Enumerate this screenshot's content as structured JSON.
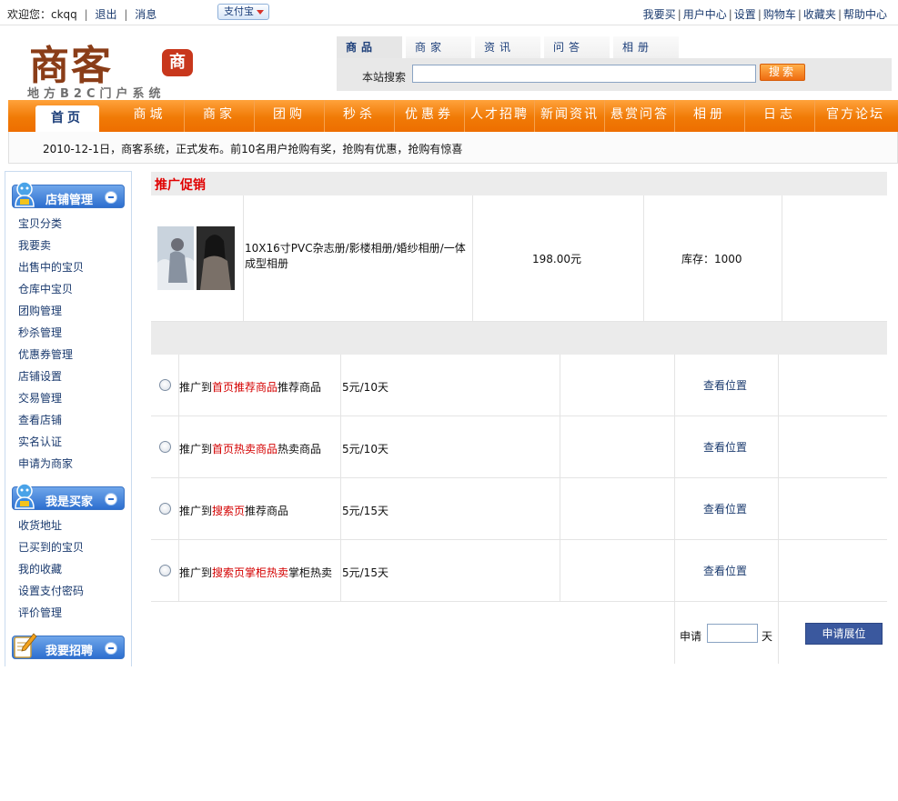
{
  "topbar": {
    "welcome": "欢迎您：ckqq",
    "logout": "退出",
    "messages": "消息",
    "alipay": "支付宝",
    "links": [
      "我要买",
      "用户中心",
      "设置",
      "购物车",
      "收藏夹",
      "帮助中心"
    ]
  },
  "logo": {
    "main": "商客",
    "seal": "商",
    "tagline": "地方B2C门户系统"
  },
  "search": {
    "tabs": [
      "商品",
      "商家",
      "资讯",
      "问答",
      "相册"
    ],
    "active_tab": "商品",
    "label": "本站搜索",
    "value": "",
    "button": "搜索"
  },
  "nav": {
    "items": [
      "首页",
      "商城",
      "商家",
      "团购",
      "秒杀",
      "优惠券",
      "人才招聘",
      "新闻资讯",
      "悬赏问答",
      "相册",
      "日志",
      "官方论坛"
    ],
    "active": "首页"
  },
  "notice": "2010-12-1日，商客系统，正式发布。前10名用户抢购有奖，抢购有优惠，抢购有惊喜",
  "sidebar": {
    "sections": [
      {
        "title": "店铺管理",
        "icon": "user-icon",
        "links": [
          "宝贝分类",
          "我要卖",
          "出售中的宝贝",
          "仓库中宝贝",
          "团购管理",
          "秒杀管理",
          "优惠券管理",
          "店铺设置",
          "交易管理",
          "查看店铺",
          "实名认证",
          "申请为商家"
        ]
      },
      {
        "title": "我是买家",
        "icon": "user-icon",
        "links": [
          "收货地址",
          "已买到的宝贝",
          "我的收藏",
          "设置支付密码",
          "评价管理"
        ]
      },
      {
        "title": "我要招聘",
        "icon": "pen-note-icon",
        "links": []
      }
    ]
  },
  "promo": {
    "title": "推广促销",
    "product": {
      "name": "10X16寸PVC杂志册/影楼相册/婚纱相册/一体成型相册",
      "price": "198.00元",
      "stock": "库存：1000"
    },
    "options": [
      {
        "pre": "推广到",
        "highlight": "首页推荐商品",
        "post": "推荐商品",
        "price": "5元/10天",
        "action": "查看位置"
      },
      {
        "pre": "推广到",
        "highlight": "首页热卖商品",
        "post": "热卖商品",
        "price": "5元/10天",
        "action": "查看位置"
      },
      {
        "pre": "推广到",
        "highlight": "搜索页",
        "post": "推荐商品",
        "price": "5元/15天",
        "action": "查看位置"
      },
      {
        "pre": "推广到",
        "highlight": "搜索页掌柜热卖",
        "post": "掌柜热卖",
        "price": "5元/15天",
        "action": "查看位置"
      }
    ],
    "apply": {
      "label": "申请",
      "days_value": "",
      "unit": "天",
      "button": "申请展位"
    }
  },
  "colors": {
    "nav_orange": "#f07a06",
    "link_blue": "#1a3a6e",
    "highlight_red": "#d40000",
    "button_blue": "#3a589e"
  }
}
